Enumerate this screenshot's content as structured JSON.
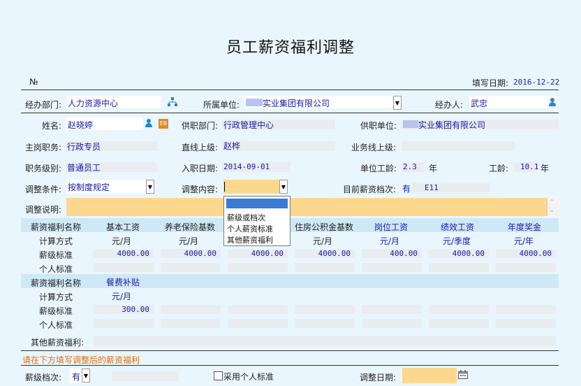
{
  "page": {
    "title": "员工薪资福利调整"
  },
  "header": {
    "no_label": "№",
    "fill_date_label": "填写日期:",
    "fill_date": "2016-12-22"
  },
  "row1": {
    "dept_label": "经办部门:",
    "dept_value": "人力资源中心",
    "unit_label": "所属单位:",
    "unit_value": "实业集团有限公司",
    "handler_label": "经办人:",
    "handler_value": "武忠"
  },
  "row2": {
    "name_label": "姓名:",
    "name_value": "赵晓婷",
    "card_icon_text": "EB",
    "work_dept_label": "供职部门:",
    "work_dept_value": "行政管理中心",
    "work_unit_label": "供职单位:",
    "work_unit_value": "实业集团有限公司"
  },
  "row3": {
    "post_label": "主岗职务:",
    "post_value": "行政专员",
    "superior_label": "直线上级:",
    "superior_value": "赵桦",
    "biz_superior_label": "业务线上级:"
  },
  "row4": {
    "level_label": "职务级别:",
    "level_value": "普通员工",
    "join_date_label": "入职日期:",
    "join_date_value": "2014-09-01",
    "unit_age_label": "单位工龄:",
    "unit_age_value": "2.3",
    "unit_age_unit": "年",
    "work_age_label": "工龄:",
    "work_age_value": "10.1",
    "work_age_unit": "年"
  },
  "row5": {
    "condition_label": "调整条件:",
    "condition_value": "按制度规定",
    "content_label": "调整内容:",
    "current_grade_label": "目前薪资档次:",
    "current_grade_flag": "有",
    "current_grade_value": "E11"
  },
  "row6": {
    "desc_label": "调整说明:"
  },
  "dropdown": {
    "options": [
      "薪级或档次",
      "个人薪资标准",
      "其他薪资福利"
    ]
  },
  "salary_table": {
    "row_labels": {
      "name": "薪资福利名称",
      "method": "计算方式",
      "standard": "薪级标准",
      "personal": "个人标准"
    },
    "columns": [
      {
        "name": "基本工资",
        "unit": "元/月",
        "standard": "4000.00"
      },
      {
        "name": "养老保险基数",
        "unit": "元/月",
        "standard": "4000.00"
      },
      {
        "name": "",
        "unit": "",
        "standard": "4000.00"
      },
      {
        "name": "住房公积金基数",
        "unit": "元/月",
        "standard": "4000.00"
      },
      {
        "name": "岗位工资",
        "unit": "元/月",
        "standard": "400.00"
      },
      {
        "name": "绩效工资",
        "unit": "元/季度",
        "standard": "4000.00"
      },
      {
        "name": "年度奖金",
        "unit": "元/年",
        "standard": "4000.00"
      }
    ]
  },
  "benefit_table": {
    "row_labels": {
      "name": "薪资福利名称",
      "method": "计算方式",
      "standard": "薪级标准",
      "personal": "个人标准"
    },
    "columns": [
      {
        "name": "餐费补贴",
        "unit": "元/月",
        "standard": "300.00"
      }
    ]
  },
  "other": {
    "label": "其他薪资福利:"
  },
  "notice": {
    "text": "请在下方填写调整后的薪资福利"
  },
  "bottom": {
    "grade_label": "薪级档次:",
    "grade_value": "有",
    "personal_std_label": "采用个人标准",
    "adjust_date_label": "调整日期:"
  },
  "colors": {
    "background": "#eaf6fd",
    "value_blue": "#1a1aa8",
    "highlight_yellow": "#fcd88f",
    "notice_orange": "#e07010",
    "band": "#cfe8f6"
  }
}
